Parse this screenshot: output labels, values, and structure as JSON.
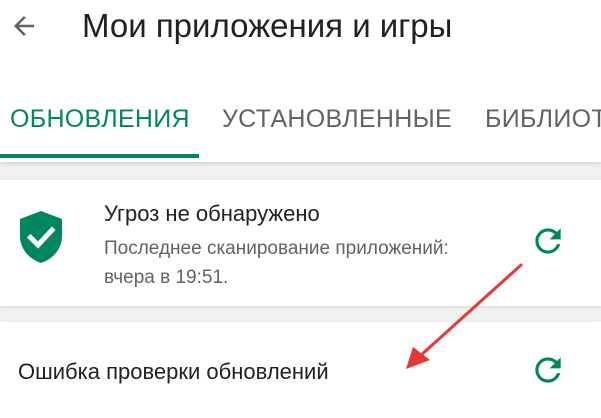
{
  "header": {
    "title": "Мои приложения и игры",
    "back_icon": "arrow-left-icon"
  },
  "tabs": [
    {
      "label": "ОБНОВЛЕНИЯ",
      "active": true
    },
    {
      "label": "УСТАНОВЛЕННЫЕ",
      "active": false
    },
    {
      "label": "БИБЛИОТ",
      "active": false
    }
  ],
  "protect_card": {
    "icon": "shield-check-icon",
    "title": "Угроз не обнаружено",
    "scan_line1": "Последнее сканирование приложений:",
    "scan_line2": "вчера в 19:51.",
    "refresh_icon": "refresh-icon"
  },
  "update_card": {
    "message": "Ошибка проверки обновлений",
    "refresh_icon": "refresh-icon"
  },
  "colors": {
    "accent": "#01875f",
    "annotation_arrow": "#e53935"
  }
}
